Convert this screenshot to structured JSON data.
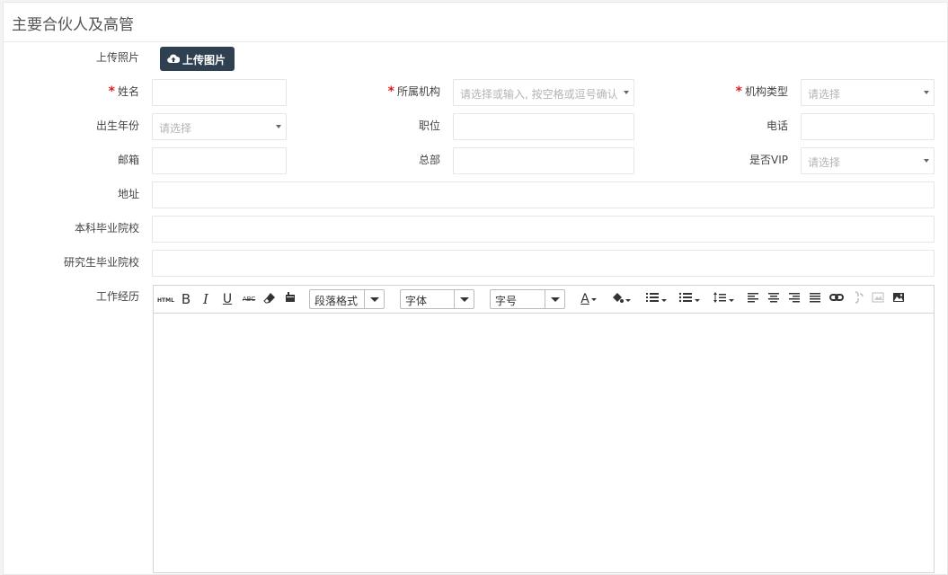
{
  "panel": {
    "title": "主要合伙人及高管"
  },
  "photo": {
    "label": "上传照片",
    "button": "上传图片"
  },
  "fields": {
    "name": {
      "label": "姓名",
      "required": "*"
    },
    "org": {
      "label": "所属机构",
      "required": "*",
      "placeholder": "请选择或输入, 按空格或逗号确认"
    },
    "org_type": {
      "label": "机构类型",
      "required": "*",
      "placeholder": "请选择"
    },
    "birth_year": {
      "label": "出生年份",
      "placeholder": "请选择"
    },
    "position": {
      "label": "职位"
    },
    "phone": {
      "label": "电话"
    },
    "email": {
      "label": "邮箱"
    },
    "hq": {
      "label": "总部"
    },
    "vip": {
      "label": "是否VIP",
      "placeholder": "请选择"
    },
    "address": {
      "label": "地址"
    },
    "undergrad": {
      "label": "本科毕业院校"
    },
    "grad": {
      "label": "研究生毕业院校"
    },
    "experience": {
      "label": "工作经历"
    }
  },
  "editor": {
    "html_label": "HTML",
    "paragraph": "段落格式",
    "font": "字体",
    "size": "字号",
    "bold": "B",
    "italic": "I",
    "underline": "U",
    "strike": "ABC",
    "font_color": "A"
  },
  "colors": {
    "button_bg": "#2f4050",
    "required": "#e01c1c"
  }
}
